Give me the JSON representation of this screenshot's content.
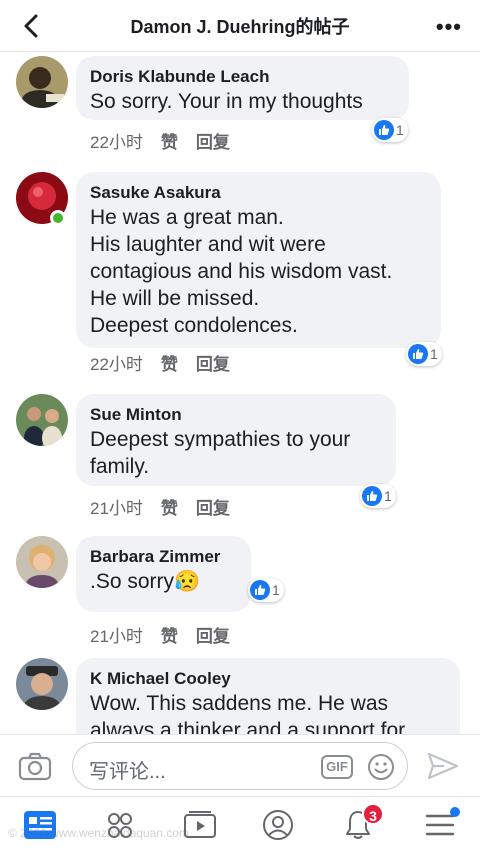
{
  "header": {
    "title": "Damon J. Duehring的帖子",
    "more_label": "•••"
  },
  "comments": [
    {
      "name": "Doris Klabunde Leach",
      "text": "So sorry. Your in my thoughts",
      "time": "22小时",
      "like": "赞",
      "reply": "回复",
      "reactions": "1"
    },
    {
      "name": "Sasuke Asakura",
      "text": "He was a great man.\nHis laughter and wit were\ncontagious and his wisdom vast.\nHe will be missed.\nDeepest condolences.",
      "time": "22小时",
      "like": "赞",
      "reply": "回复",
      "reactions": "1"
    },
    {
      "name": "Sue Minton",
      "text": "Deepest sympathies to your\nfamily.",
      "time": "21小时",
      "like": "赞",
      "reply": "回复",
      "reactions": "1"
    },
    {
      "name": "Barbara Zimmer",
      "text": ".So sorry😥",
      "time": "21小时",
      "like": "赞",
      "reply": "回复",
      "reactions": "1"
    },
    {
      "name": "K Michael Cooley",
      "text": "Wow.  This saddens me.  He was\nalways a thinker and a support for",
      "time": "",
      "like": "",
      "reply": "",
      "reactions": ""
    }
  ],
  "composer": {
    "placeholder": "写评论...",
    "gif_label": "GIF"
  },
  "tabbar": {
    "notification_count": "3"
  },
  "watermark": "© 2021 www.wenzhaidaquan.com"
}
